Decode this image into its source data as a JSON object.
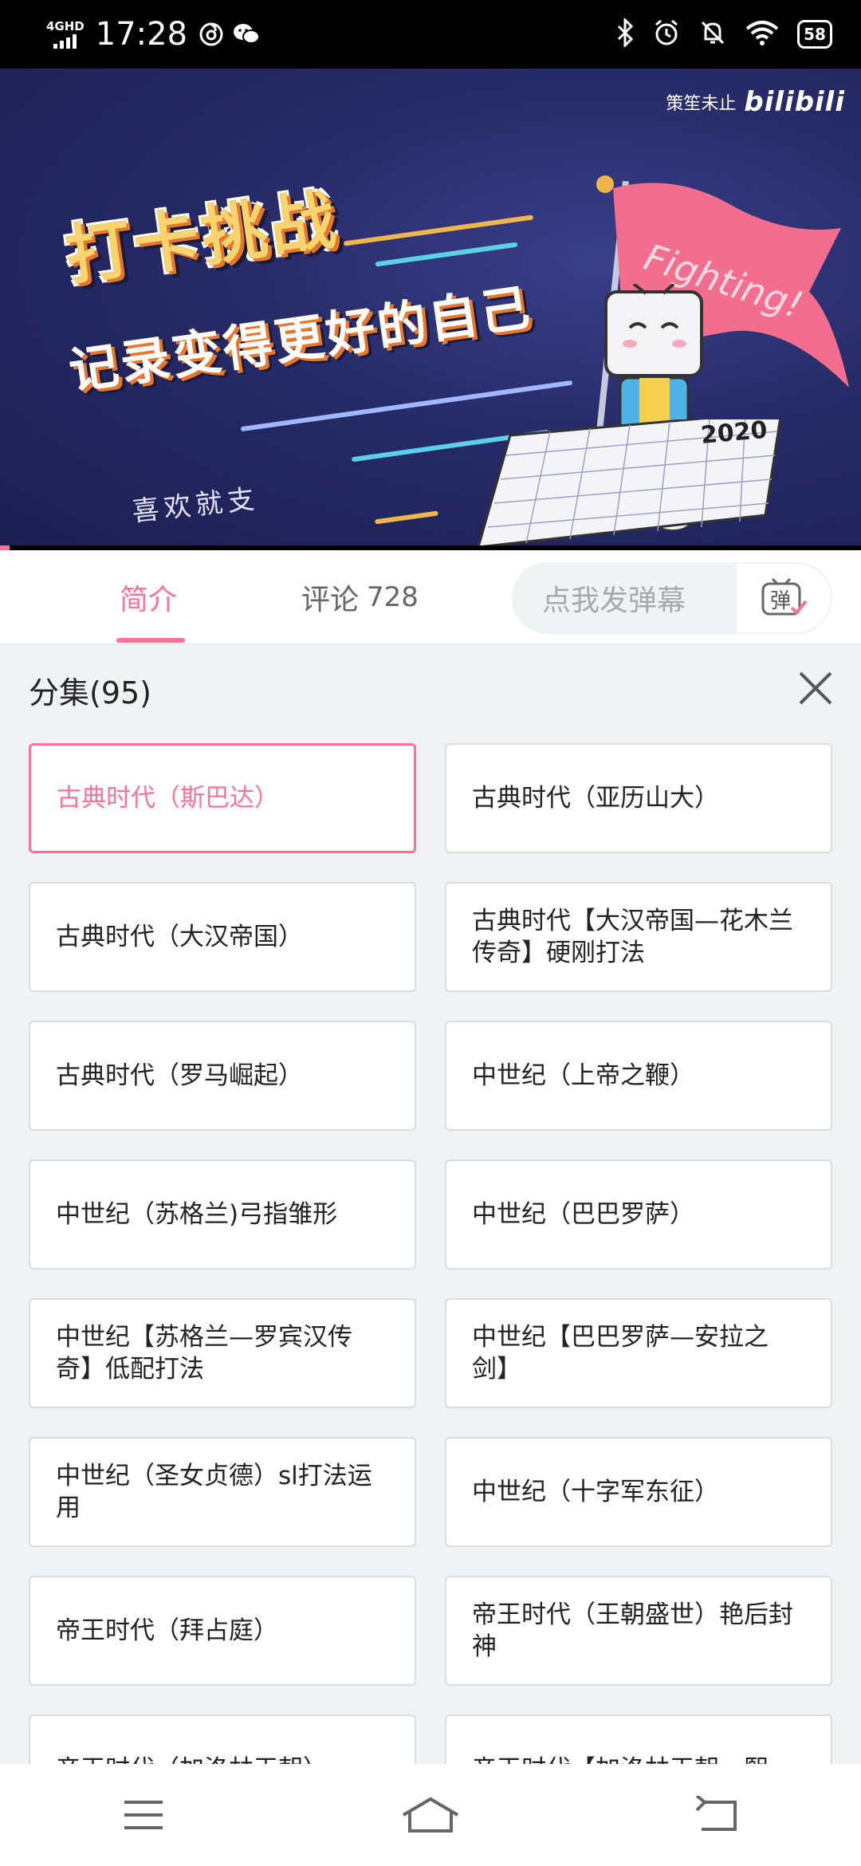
{
  "status_bar": {
    "network": "4GHD",
    "time": "17:28",
    "battery": "58"
  },
  "video": {
    "watermark_author": "策笙未止",
    "watermark_logo": "bilibili",
    "title_line1": "打卡挑战",
    "title_line2": "记录变得更好的自己",
    "flag_text": "Fighting!",
    "note_text": "喜欢就支",
    "calendar_year": "2020"
  },
  "tabs": {
    "intro_label": "简介",
    "comment_label": "评论",
    "comment_count": "728",
    "danmaku_placeholder": "点我发弹幕",
    "danmaku_btn_label": "弹"
  },
  "colors": {
    "accent": "#fb7299",
    "panel_bg": "#f1f2f4"
  },
  "episode_panel": {
    "title": "分集(95)",
    "items": [
      {
        "label": "古典时代（斯巴达）",
        "active": true
      },
      {
        "label": "古典时代（亚历山大）"
      },
      {
        "label": "古典时代（大汉帝国）"
      },
      {
        "label": "古典时代【大汉帝国—花木兰传奇】硬刚打法"
      },
      {
        "label": "古典时代（罗马崛起）"
      },
      {
        "label": "中世纪（上帝之鞭）"
      },
      {
        "label": "中世纪（苏格兰)弓指雏形"
      },
      {
        "label": "中世纪（巴巴罗萨）"
      },
      {
        "label": "中世纪【苏格兰—罗宾汉传奇】低配打法"
      },
      {
        "label": "中世纪【巴巴罗萨—安拉之剑】"
      },
      {
        "label": "中世纪（圣女贞德）sl打法运用"
      },
      {
        "label": "中世纪（十字军东征）"
      },
      {
        "label": "帝王时代（拜占庭）"
      },
      {
        "label": "帝王时代（王朝盛世）艳后封神"
      },
      {
        "label": "帝王时代（加洛林王朝）"
      },
      {
        "label": "帝王时代【加洛林王朝—熙"
      }
    ]
  }
}
